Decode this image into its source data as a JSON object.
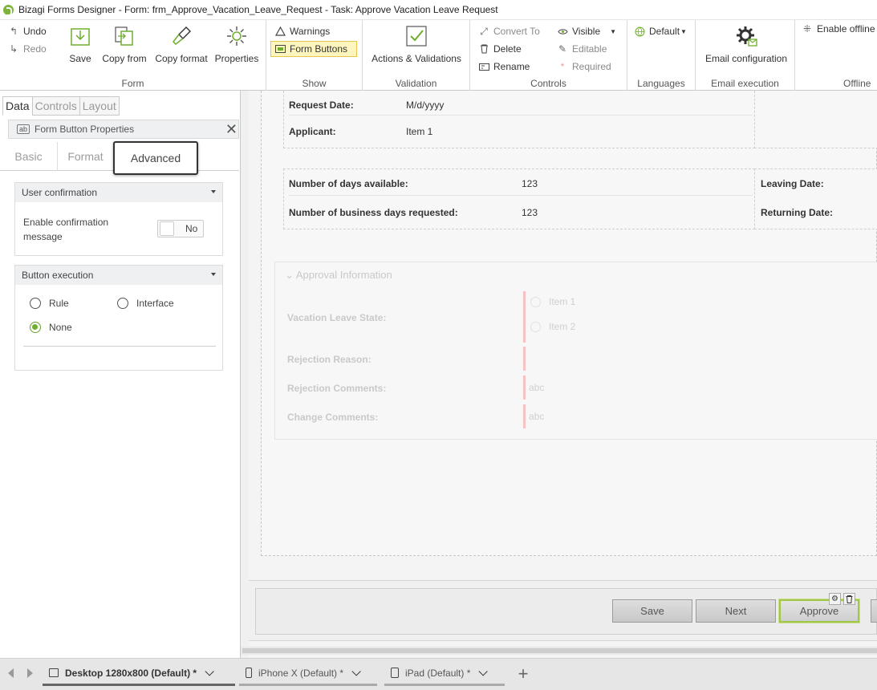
{
  "window": {
    "title": "Bizagi Forms Designer  - Form: frm_Approve_Vacation_Leave_Request - Task:  Approve Vacation Leave Request"
  },
  "ribbon": {
    "form": {
      "label": "Form",
      "undo": "Undo",
      "redo": "Redo",
      "save": "Save",
      "copy_from": "Copy from",
      "copy_format": "Copy format",
      "properties": "Properties"
    },
    "show": {
      "label": "Show",
      "warnings": "Warnings",
      "form_buttons": "Form Buttons"
    },
    "validation": {
      "label": "Validation",
      "actions": "Actions & Validations"
    },
    "controls": {
      "label": "Controls",
      "convert_to": "Convert To",
      "delete": "Delete",
      "rename": "Rename",
      "visible": "Visible",
      "editable": "Editable",
      "required": "Required"
    },
    "languages": {
      "label": "Languages",
      "default": "Default"
    },
    "email": {
      "label": "Email execution",
      "config": "Email configuration"
    },
    "offline": {
      "label": "Offline",
      "enable": "Enable offline"
    }
  },
  "left_panel": {
    "tabs": [
      "Data",
      "Controls",
      "Layout"
    ],
    "properties_title": "Form Button Properties",
    "subtabs": [
      "Basic",
      "Format",
      "Advanced"
    ],
    "user_confirmation": {
      "title": "User confirmation",
      "label": "Enable confirmation message",
      "value": "No"
    },
    "button_execution": {
      "title": "Button execution",
      "options": [
        "Rule",
        "Interface",
        "None"
      ],
      "selected": "None"
    }
  },
  "form": {
    "request_date": {
      "label": "Request Date:",
      "value": "M/d/yyyy"
    },
    "applicant": {
      "label": "Applicant:",
      "value": "Item 1"
    },
    "days_available": {
      "label": "Number of days available:",
      "value": "123"
    },
    "business_days": {
      "label": "Number of business days requested:",
      "value": "123"
    },
    "leaving_date": {
      "label": "Leaving Date:"
    },
    "returning_date": {
      "label": "Returning Date:"
    },
    "approval": {
      "title": "Approval Information",
      "state_label": "Vacation Leave State:",
      "state_items": [
        "Item 1",
        "Item 2"
      ],
      "rejection_reason": "Rejection Reason:",
      "rejection_comments": "Rejection Comments:",
      "rejection_comments_ph": "abc",
      "change_comments": "Change Comments:",
      "change_comments_ph": "abc"
    },
    "buttons": {
      "save": "Save",
      "next": "Next",
      "approve": "Approve"
    }
  },
  "devices": [
    {
      "label": "Desktop 1280x800 (Default)",
      "modified": "*"
    },
    {
      "label": "iPhone X (Default)",
      "modified": "*"
    },
    {
      "label": "iPad (Default)",
      "modified": "*"
    }
  ],
  "colors": {
    "accent": "#7db53a",
    "selected_border": "#a0c64a",
    "required_bar": "#f6c2c4"
  }
}
